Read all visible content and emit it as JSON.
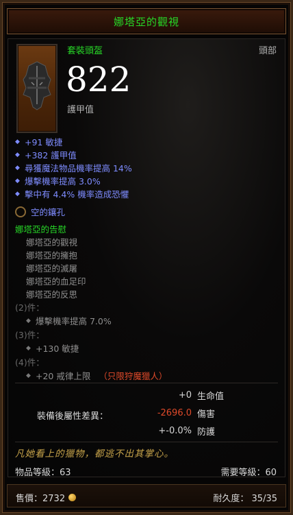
{
  "item": {
    "name": "娜塔亞的觀視",
    "type": "套裝頭盔",
    "slot": "頭部",
    "armor_value": "822",
    "armor_label": "護甲值"
  },
  "primary_stats": [
    "+91 敏捷",
    "+382 護甲值",
    "尋獲魔法物品機率提高 14%",
    "爆擊機率提高 3.0%",
    "擊中有 4.4% 機率造成恐懼"
  ],
  "socket": {
    "label": "空的鑲孔"
  },
  "set": {
    "name": "娜塔亞的告慰",
    "pieces": [
      "娜塔亞的觀視",
      "娜塔亞的擁抱",
      "娜塔亞的滅屠",
      "娜塔亞的血足印",
      "娜塔亞的反思"
    ],
    "bonuses": [
      {
        "count": "(2)件：",
        "text": "爆擊機率提高 7.0%",
        "req": ""
      },
      {
        "count": "(3)件：",
        "text": "+130 敏捷",
        "req": ""
      },
      {
        "count": "(4)件：",
        "text": "+20 戒律上限",
        "req": "（只限狩魔獵人）"
      }
    ]
  },
  "comparison": {
    "title": "裝備後屬性差異：",
    "rows": [
      {
        "value": "+0",
        "label": "生命值",
        "color": "#d8d8d8"
      },
      {
        "value": "-2696.0",
        "label": "傷害",
        "color": "#e04a2a"
      },
      {
        "value": "+-0.0%",
        "label": "防護",
        "color": "#d8d8d8"
      }
    ]
  },
  "flavor_text": "凡她看上的獵物，都逃不出其掌心。",
  "item_level": "物品等級：63",
  "required_level": "需要等級：60",
  "footer": {
    "sell_price": "售價：2732",
    "durability": "耐久度： 35/35"
  },
  "colors": {
    "set_green": "#27d827",
    "magic_blue": "#7e8cff",
    "negative_red": "#e04a2a",
    "flavor_gold": "#c6a34a"
  }
}
